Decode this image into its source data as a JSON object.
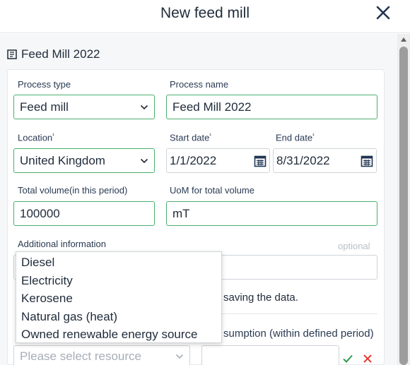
{
  "dialog": {
    "title": "New feed mill"
  },
  "section": {
    "title": "Feed Mill 2022"
  },
  "form": {
    "process_type": {
      "label": "Process type",
      "value": "Feed mill"
    },
    "process_name": {
      "label": "Process name",
      "value": "Feed Mill 2022"
    },
    "location": {
      "label": "Location",
      "marker": "¹",
      "value": "United Kingdom"
    },
    "start_date": {
      "label": "Start date",
      "marker": "¹",
      "value": "1/1/2022"
    },
    "end_date": {
      "label": "End date",
      "marker": "¹",
      "value": "8/31/2022"
    },
    "total_volume": {
      "label": "Total volume(in this period)",
      "value": "100000"
    },
    "uom": {
      "label": "UoM for total volume",
      "value": "mT"
    },
    "additional_info": {
      "label": "Additional information",
      "optional": "optional"
    },
    "save_note": "saving the data.",
    "consumption_label": "sumption (within defined period)",
    "resource": {
      "placeholder": "Please select resource"
    }
  },
  "resource_dropdown": {
    "options": [
      "Diesel",
      "Electricity",
      "Kerosene",
      "Natural gas (heat)",
      "Owned renewable energy source"
    ]
  },
  "colors": {
    "accent_green": "#4caf6f",
    "confirm_green": "#2e9b4f",
    "cancel_red": "#e53935",
    "close_navy": "#1f3552"
  }
}
